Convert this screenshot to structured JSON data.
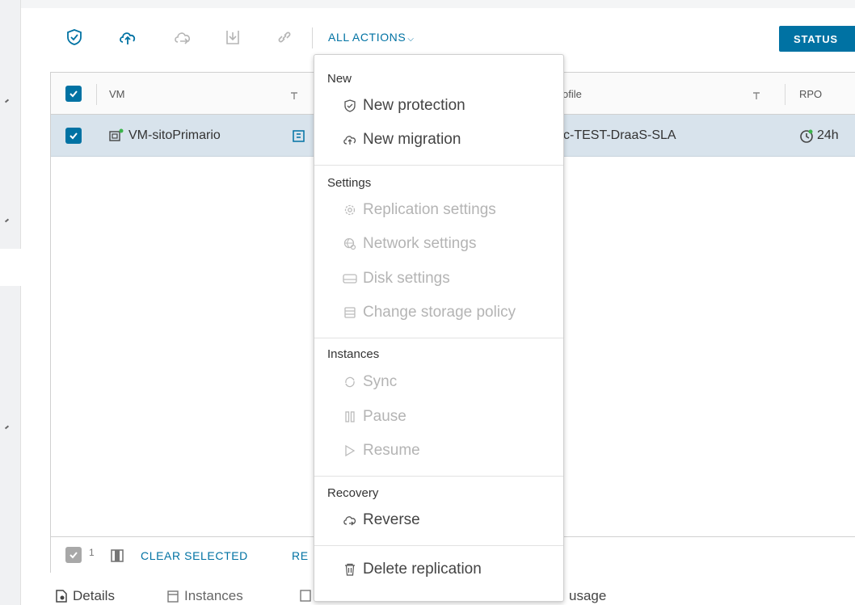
{
  "toolbar": {
    "icons": [
      "shield-check-icon",
      "cloud-upload-icon",
      "cloud-sync-icon",
      "download-icon",
      "link-icon"
    ],
    "all_actions_label": "ALL ACTIONS",
    "status_label": "STATUS"
  },
  "grid": {
    "columns": [
      {
        "label": "VM"
      },
      {
        "label": "ofile"
      },
      {
        "label": "RPO"
      }
    ],
    "rows": [
      {
        "vm": "VM-sitoPrimario",
        "profile": "c-TEST-DraaS-SLA",
        "rpo": "24h",
        "selected": true
      }
    ],
    "footer": {
      "selected_count": "1",
      "clear_selected": "CLEAR SELECTED",
      "truncated_link": "RE"
    }
  },
  "menu": {
    "sections": [
      {
        "header": "New",
        "items": [
          {
            "label": "New protection",
            "icon": "shield-check-icon",
            "enabled": true
          },
          {
            "label": "New migration",
            "icon": "cloud-upload-icon",
            "enabled": true
          }
        ]
      },
      {
        "header": "Settings",
        "items": [
          {
            "label": "Replication settings",
            "icon": "gear-icon",
            "enabled": false
          },
          {
            "label": "Network settings",
            "icon": "network-icon",
            "enabled": false
          },
          {
            "label": "Disk settings",
            "icon": "disk-icon",
            "enabled": false
          },
          {
            "label": "Change storage policy",
            "icon": "database-icon",
            "enabled": false
          }
        ]
      },
      {
        "header": "Instances",
        "items": [
          {
            "label": "Sync",
            "icon": "sync-icon",
            "enabled": false
          },
          {
            "label": "Pause",
            "icon": "pause-icon",
            "enabled": false
          },
          {
            "label": "Resume",
            "icon": "play-icon",
            "enabled": false
          }
        ]
      },
      {
        "header": "Recovery",
        "items": [
          {
            "label": "Reverse",
            "icon": "cloud-reverse-icon",
            "enabled": true
          }
        ]
      },
      {
        "header": "",
        "items": [
          {
            "label": "Delete replication",
            "icon": "trash-icon",
            "enabled": true
          }
        ]
      }
    ]
  },
  "bottom_tabs": {
    "details": "Details",
    "instances": "Instances",
    "partial_usage": "usage"
  },
  "colors": {
    "accent": "#0072a3",
    "row_selected": "#d8e3ec",
    "disabled_text": "#b4b4b4"
  }
}
